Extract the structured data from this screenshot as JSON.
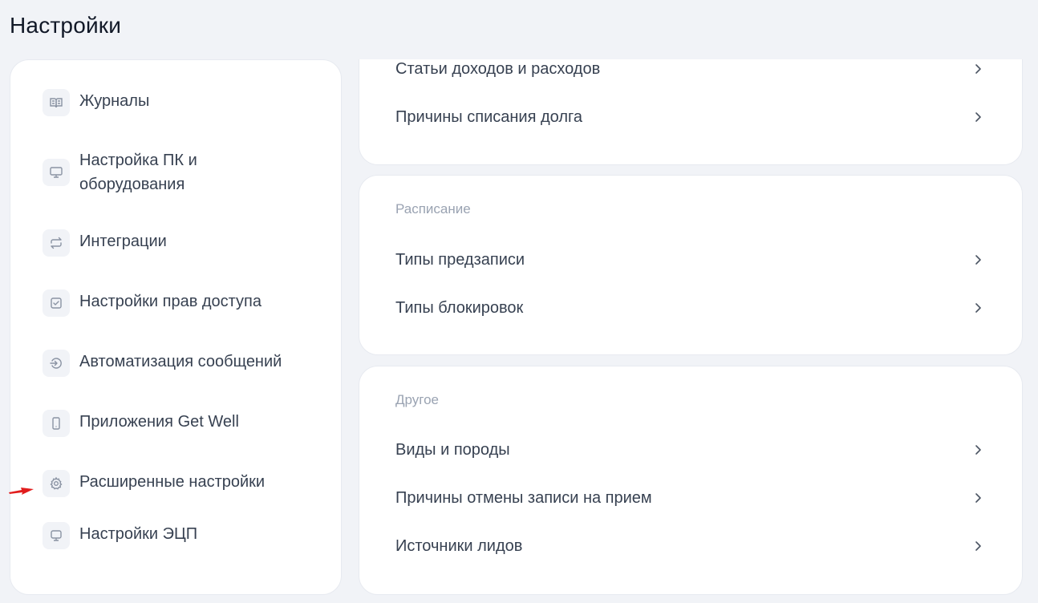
{
  "page": {
    "title": "Настройки"
  },
  "sidebar": {
    "items": [
      {
        "label": "Журналы",
        "icon": "book-icon"
      },
      {
        "label": "Настройка ПК и оборудования",
        "icon": "monitor-icon"
      },
      {
        "label": "Интеграции",
        "icon": "sync-arrows-icon"
      },
      {
        "label": "Настройки прав доступа",
        "icon": "checkbox-icon"
      },
      {
        "label": "Автоматизация сообщений",
        "icon": "message-automation-icon"
      },
      {
        "label": "Приложения Get Well",
        "icon": "mobile-phone-icon"
      },
      {
        "label": "Расширенные настройки",
        "icon": "gear-icon"
      },
      {
        "label": "Настройки ЭЦП",
        "icon": "monitor-icon"
      }
    ]
  },
  "finance": {
    "rows": [
      {
        "label": "Статьи доходов и расходов"
      },
      {
        "label": "Причины списания долга"
      }
    ]
  },
  "schedule": {
    "title": "Расписание",
    "rows": [
      {
        "label": "Типы предзаписи"
      },
      {
        "label": "Типы блокировок"
      }
    ]
  },
  "other": {
    "title": "Другое",
    "rows": [
      {
        "label": "Виды и породы"
      },
      {
        "label": "Причины отмены записи на прием"
      },
      {
        "label": "Источники лидов"
      }
    ]
  },
  "colors": {
    "background": "#f1f3f7",
    "card": "#ffffff",
    "text": "#374151",
    "muted": "#9aa3b2",
    "annotation_arrow": "#e11d1d"
  }
}
